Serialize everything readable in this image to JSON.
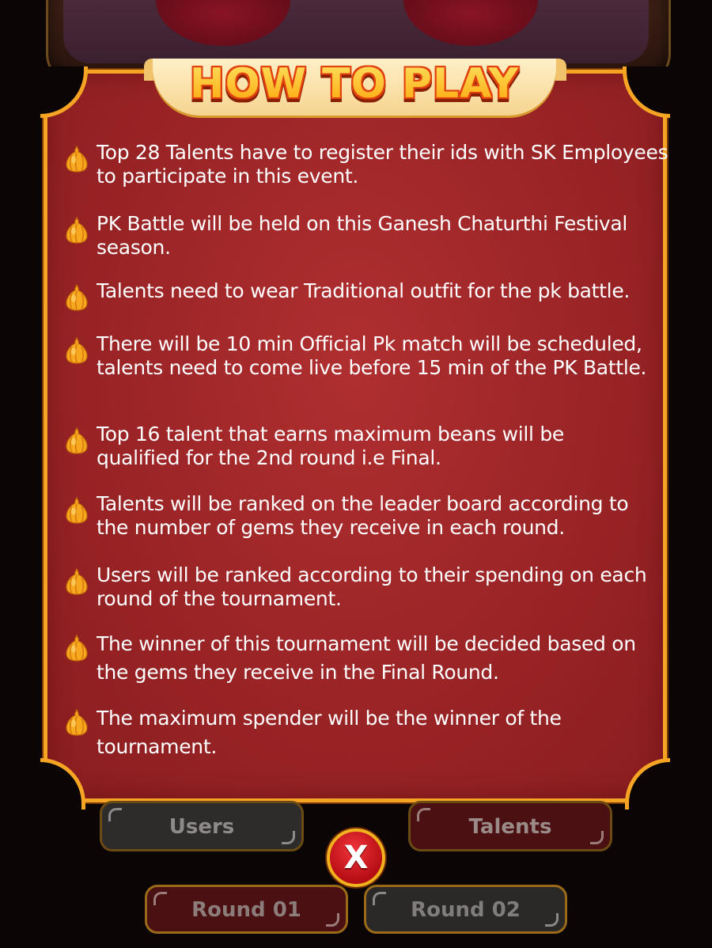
{
  "title": "HOW TO PLAY",
  "rules": [
    "Top 28 Talents have to register their ids with SK Employees to participate in this event.",
    "PK Battle will be held on this Ganesh Chaturthi Festival season.",
    "Talents need to wear Traditional outfit for the pk battle.",
    "There will be 10 min Official Pk match will be scheduled, talents need to come live before 15 min of the PK Battle.",
    "Top 16 talent that earns maximum beans will be qualified for the 2nd round i.e Final.",
    "Talents will be ranked on the leader board according to the number of gems they receive in each round.",
    "Users will be ranked according to their spending on each round of the tournament.",
    "The winner of this tournament will be decided based on the gems they receive in the Final Round.",
    "The maximum spender will be the winner of the tournament."
  ],
  "bullet_icon": "modak-icon",
  "buttons": {
    "users": "Users",
    "talents": "Talents",
    "round1": "Round 01",
    "round2": "Round 02",
    "close": "X"
  },
  "colors": {
    "panel_red": "#9a2426",
    "border_gold": "#f5a523",
    "title_yellow": "#ffd23a"
  }
}
